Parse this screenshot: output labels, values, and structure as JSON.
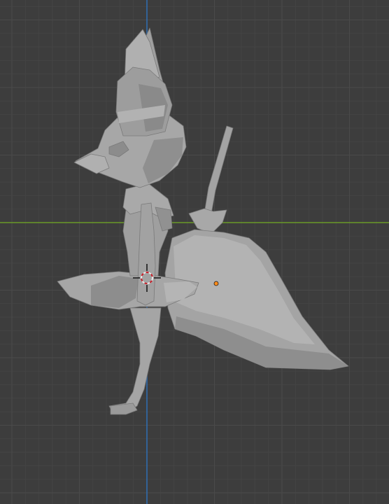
{
  "viewport": {
    "background_color": "#3d3d3d",
    "grid_minor_color": "#444444",
    "grid_major_color": "#4a4a4a",
    "axis_x_color": "#6a9a28",
    "axis_z_color": "#2f6fb5",
    "model_color": "#9c9c9c",
    "model_shadow_color": "#6e6e6e",
    "model_highlight_color": "#bdbdbd",
    "origin_dot_color": "#ff8c1a",
    "cursor_ring_colors": [
      "#e8e8e8",
      "#c8202a"
    ]
  },
  "icons": {
    "cursor": "3d-cursor-icon",
    "origin": "object-origin-icon"
  }
}
